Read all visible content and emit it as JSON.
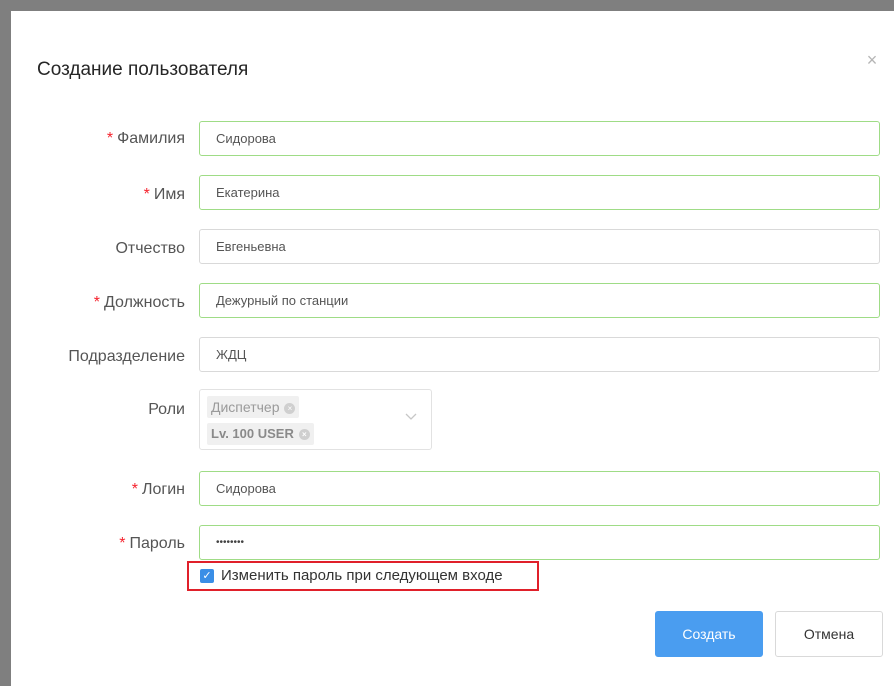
{
  "dialog": {
    "title": "Создание пользователя",
    "close_glyph": "×"
  },
  "form": {
    "required_mark": "*",
    "last_name": {
      "label": "Фамилия",
      "value": "Сидорова"
    },
    "first_name": {
      "label": "Имя",
      "value": "Екатерина"
    },
    "patronymic": {
      "label": "Отчество",
      "value": "Евгеньевна"
    },
    "position": {
      "label": "Должность",
      "value": "Дежурный по станции"
    },
    "department": {
      "label": "Подразделение",
      "value": "ЖДЦ"
    },
    "roles": {
      "label": "Роли",
      "tags": [
        "Диспетчер",
        "Lv. 100 USER"
      ],
      "tag_remove_glyph": "×",
      "dropdown_icon": "chevron-down-icon"
    },
    "login": {
      "label": "Логин",
      "value": "Сидорова"
    },
    "password": {
      "label": "Пароль",
      "value": "••••••••"
    },
    "change_password": {
      "label": "Изменить пароль при следующем входе",
      "checked": true,
      "check_glyph": "✓"
    }
  },
  "actions": {
    "create_label": "Создать",
    "cancel_label": "Отмена"
  },
  "colors": {
    "primary": "#4a9df0",
    "required": "#f5222d",
    "valid_border": "#9fdc86",
    "highlight": "#e0202a"
  }
}
